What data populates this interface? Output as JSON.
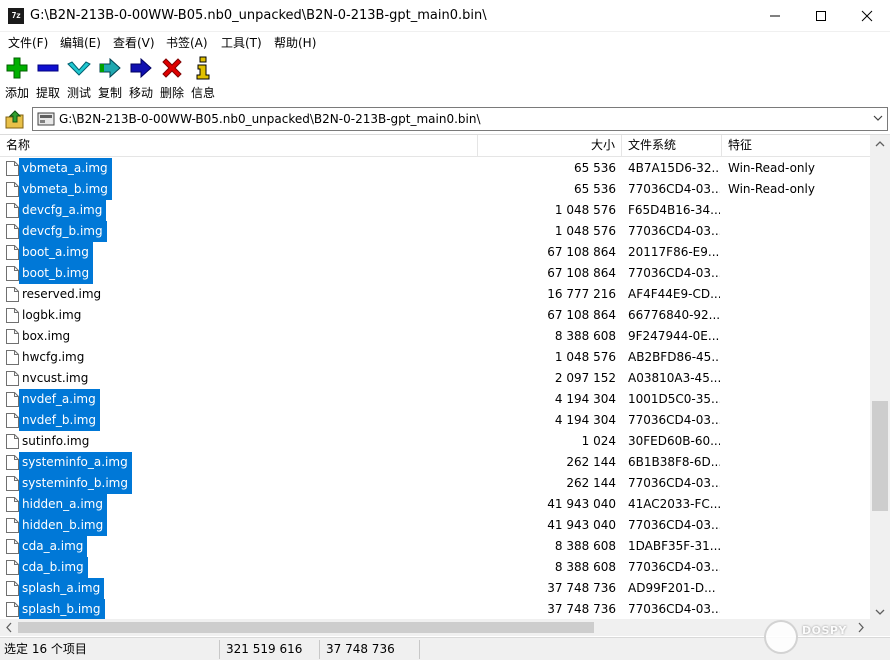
{
  "window": {
    "title": "G:\\B2N-213B-0-00WW-B05.nb0_unpacked\\B2N-0-213B-gpt_main0.bin\\",
    "app_icon_text": "7z"
  },
  "menu": [
    {
      "label": "文件(F)"
    },
    {
      "label": "编辑(E)"
    },
    {
      "label": "查看(V)"
    },
    {
      "label": "书签(A)"
    },
    {
      "label": "工具(T)"
    },
    {
      "label": "帮助(H)"
    }
  ],
  "toolbar": {
    "add": "添加",
    "extract": "提取",
    "test": "测试",
    "copy": "复制",
    "move": "移动",
    "delete": "删除",
    "info": "信息"
  },
  "address": {
    "path": "G:\\B2N-213B-0-00WW-B05.nb0_unpacked\\B2N-0-213B-gpt_main0.bin\\"
  },
  "columns": {
    "name": "名称",
    "size": "大小",
    "filesystem": "文件系统",
    "attributes": "特征"
  },
  "files": [
    {
      "name": "vbmeta_a.img",
      "size": "65 536",
      "fs": "4B7A15D6-32...",
      "attr": "Win-Read-only",
      "selected": true
    },
    {
      "name": "vbmeta_b.img",
      "size": "65 536",
      "fs": "77036CD4-03...",
      "attr": "Win-Read-only",
      "selected": true
    },
    {
      "name": "devcfg_a.img",
      "size": "1 048 576",
      "fs": "F65D4B16-34...",
      "attr": "",
      "selected": true
    },
    {
      "name": "devcfg_b.img",
      "size": "1 048 576",
      "fs": "77036CD4-03...",
      "attr": "",
      "selected": true
    },
    {
      "name": "boot_a.img",
      "size": "67 108 864",
      "fs": "20117F86-E9...",
      "attr": "",
      "selected": true
    },
    {
      "name": "boot_b.img",
      "size": "67 108 864",
      "fs": "77036CD4-03...",
      "attr": "",
      "selected": true
    },
    {
      "name": "reserved.img",
      "size": "16 777 216",
      "fs": "AF4F44E9-CD...",
      "attr": "",
      "selected": false
    },
    {
      "name": "logbk.img",
      "size": "67 108 864",
      "fs": "66776840-92...",
      "attr": "",
      "selected": false
    },
    {
      "name": "box.img",
      "size": "8 388 608",
      "fs": "9F247944-0E...",
      "attr": "",
      "selected": false
    },
    {
      "name": "hwcfg.img",
      "size": "1 048 576",
      "fs": "AB2BFD86-45...",
      "attr": "",
      "selected": false
    },
    {
      "name": "nvcust.img",
      "size": "2 097 152",
      "fs": "A03810A3-45...",
      "attr": "",
      "selected": false
    },
    {
      "name": "nvdef_a.img",
      "size": "4 194 304",
      "fs": "1001D5C0-35...",
      "attr": "",
      "selected": true
    },
    {
      "name": "nvdef_b.img",
      "size": "4 194 304",
      "fs": "77036CD4-03...",
      "attr": "",
      "selected": true
    },
    {
      "name": "sutinfo.img",
      "size": "1 024",
      "fs": "30FED60B-60...",
      "attr": "",
      "selected": false
    },
    {
      "name": "systeminfo_a.img",
      "size": "262 144",
      "fs": "6B1B38F8-6D...",
      "attr": "",
      "selected": true
    },
    {
      "name": "systeminfo_b.img",
      "size": "262 144",
      "fs": "77036CD4-03...",
      "attr": "",
      "selected": true
    },
    {
      "name": "hidden_a.img",
      "size": "41 943 040",
      "fs": "41AC2033-FC...",
      "attr": "",
      "selected": true
    },
    {
      "name": "hidden_b.img",
      "size": "41 943 040",
      "fs": "77036CD4-03...",
      "attr": "",
      "selected": true
    },
    {
      "name": "cda_a.img",
      "size": "8 388 608",
      "fs": "1DABF35F-31...",
      "attr": "",
      "selected": true
    },
    {
      "name": "cda_b.img",
      "size": "8 388 608",
      "fs": "77036CD4-03...",
      "attr": "",
      "selected": true
    },
    {
      "name": "splash_a.img",
      "size": "37 748 736",
      "fs": "AD99F201-D...",
      "attr": "",
      "selected": true
    },
    {
      "name": "splash_b.img",
      "size": "37 748 736",
      "fs": "77036CD4-03...",
      "attr": "",
      "selected": true
    }
  ],
  "scroll": {
    "vertical_position_fraction": 0.62,
    "horizontal_position_fraction": 0.0
  },
  "status": {
    "selection": "选定 16 个项目",
    "total_size": "321 519 616",
    "item_size": "37 748 736"
  },
  "watermark": {
    "text": "DOSPY"
  },
  "colors": {
    "selection": "#0078d7",
    "add_icon": "#00b000",
    "extract_icon": "#1010d0",
    "test_icon": "#20c8d0",
    "delete_icon": "#e00000",
    "info_icon": "#e0c000"
  }
}
